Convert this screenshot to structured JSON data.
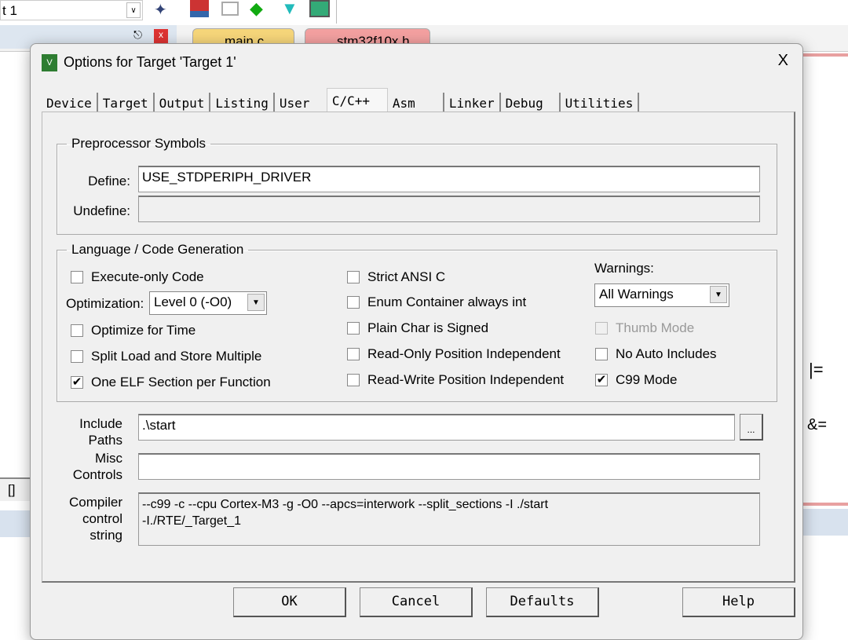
{
  "background": {
    "target_combo": "t 1",
    "tabs": [
      "main.c",
      "stm32f10x.h"
    ],
    "code_fragments": [
      "|=",
      "&=",
      "[]"
    ]
  },
  "dialog": {
    "title": "Options for Target 'Target 1'",
    "close": "X",
    "tabs": [
      "Device",
      "Target",
      "Output",
      "Listing",
      "User",
      "C/C++",
      "Asm",
      "Linker",
      "Debug",
      "Utilities"
    ],
    "active_tab": "C/C++",
    "preprocessor": {
      "legend": "Preprocessor Symbols",
      "define_label": "Define:",
      "define_value": "USE_STDPERIPH_DRIVER",
      "undefine_label": "Undefine:",
      "undefine_value": ""
    },
    "language": {
      "legend": "Language / Code Generation",
      "execute_only": {
        "label": "Execute-only Code",
        "checked": false
      },
      "optimization_label": "Optimization:",
      "optimization_value": "Level 0 (-O0)",
      "optimize_time": {
        "label": "Optimize for Time",
        "checked": false
      },
      "split_load": {
        "label": "Split Load and Store Multiple",
        "checked": false
      },
      "one_elf": {
        "label": "One ELF Section per Function",
        "checked": true
      },
      "strict_ansi": {
        "label": "Strict ANSI C",
        "checked": false
      },
      "enum_container": {
        "label": "Enum Container always int",
        "checked": false
      },
      "plain_char": {
        "label": "Plain Char is Signed",
        "checked": false
      },
      "ropi": {
        "label": "Read-Only Position Independent",
        "checked": false
      },
      "rwpi": {
        "label": "Read-Write Position Independent",
        "checked": false
      },
      "warnings_label": "Warnings:",
      "warnings_value": "All Warnings",
      "thumb_mode": {
        "label": "Thumb Mode",
        "checked": false,
        "disabled": true
      },
      "no_auto_includes": {
        "label": "No Auto Includes",
        "checked": false
      },
      "c99_mode": {
        "label": "C99 Mode",
        "checked": true
      }
    },
    "include_label_1": "Include",
    "include_label_2": "Paths",
    "include_value": ".\\start",
    "browse": "...",
    "misc_label_1": "Misc",
    "misc_label_2": "Controls",
    "misc_value": "",
    "compiler_label_1": "Compiler",
    "compiler_label_2": "control",
    "compiler_label_3": "string",
    "compiler_line_1": "--c99 -c --cpu Cortex-M3 -g -O0 --apcs=interwork --split_sections -I ./start",
    "compiler_line_2": "-I./RTE/_Target_1",
    "buttons": {
      "ok": "OK",
      "cancel": "Cancel",
      "defaults": "Defaults",
      "help": "Help"
    }
  }
}
